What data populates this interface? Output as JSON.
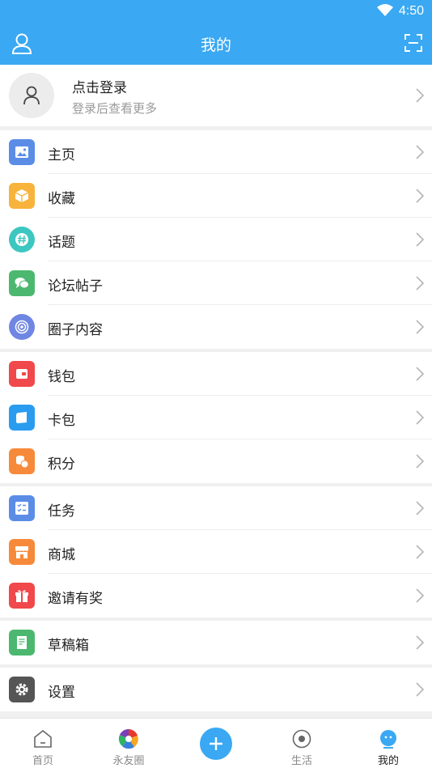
{
  "status_bar": {
    "time": "4:50"
  },
  "app_bar": {
    "title": "我的"
  },
  "login": {
    "name": "点击登录",
    "subtitle": "登录后查看更多"
  },
  "menu_groups": [
    [
      {
        "label": "主页",
        "icon": "image-icon",
        "color": "#5b8de6"
      },
      {
        "label": "收藏",
        "icon": "box-icon",
        "color": "#f7b33b"
      },
      {
        "label": "话题",
        "icon": "hashtag-icon",
        "color": "#3cc7c0"
      },
      {
        "label": "论坛帖子",
        "icon": "chat-icon",
        "color": "#4cb86f"
      },
      {
        "label": "圈子内容",
        "icon": "circle-icon",
        "color": "#6f86e3"
      }
    ],
    [
      {
        "label": "钱包",
        "icon": "wallet-icon",
        "color": "#f0484b"
      },
      {
        "label": "卡包",
        "icon": "card-icon",
        "color": "#2a9cf0"
      },
      {
        "label": "积分",
        "icon": "coins-icon",
        "color": "#f78a3a"
      }
    ],
    [
      {
        "label": "任务",
        "icon": "task-list-icon",
        "color": "#5b8de6"
      },
      {
        "label": "商城",
        "icon": "store-icon",
        "color": "#f78a3a"
      },
      {
        "label": "邀请有奖",
        "icon": "gift-icon",
        "color": "#f0484b"
      }
    ],
    [
      {
        "label": "草稿箱",
        "icon": "draft-icon",
        "color": "#4cb86f"
      }
    ],
    [
      {
        "label": "设置",
        "icon": "gear-icon",
        "color": "#555555"
      }
    ]
  ],
  "tab_bar": {
    "tabs": [
      {
        "label": "首页",
        "icon": "home-icon"
      },
      {
        "label": "永友圈",
        "icon": "circle-logo-icon"
      },
      {
        "label": "",
        "icon": "plus-icon"
      },
      {
        "label": "生活",
        "icon": "life-icon"
      },
      {
        "label": "我的",
        "icon": "profile-icon",
        "active": true
      }
    ]
  },
  "colors": {
    "primary": "#3aa8f2",
    "text": "#222222",
    "secondary": "#9a9a9a"
  }
}
